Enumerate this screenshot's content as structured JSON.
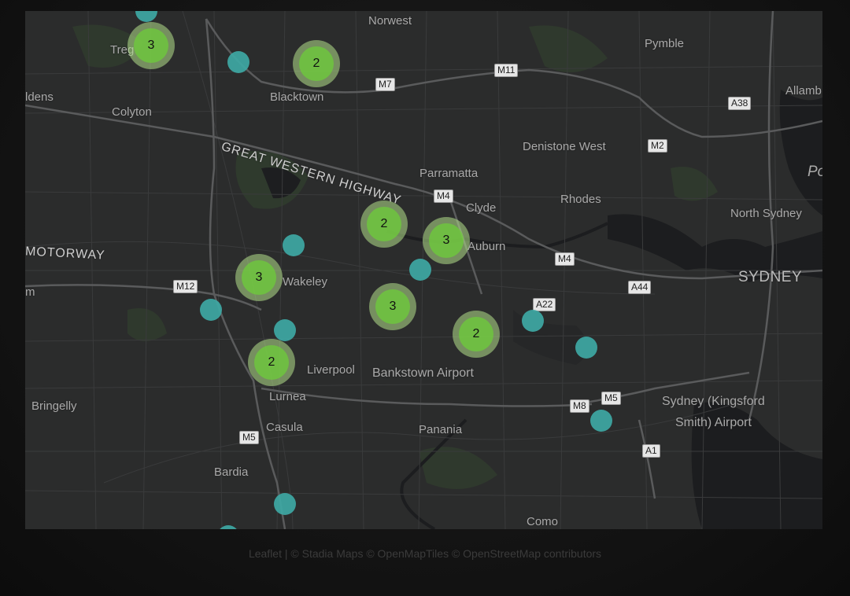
{
  "map": {
    "places": [
      {
        "key": "norwest",
        "text": "Norwest"
      },
      {
        "key": "pymble",
        "text": "Pymble"
      },
      {
        "key": "allamb",
        "text": "Allamb"
      },
      {
        "key": "tregear",
        "text": "Treg"
      },
      {
        "key": "blacktown",
        "text": "Blacktown"
      },
      {
        "key": "eldens",
        "text": "ldens"
      },
      {
        "key": "colyton",
        "text": "Colyton"
      },
      {
        "key": "denistone",
        "text": "Denistone West"
      },
      {
        "key": "parramatta",
        "text": "Parramatta"
      },
      {
        "key": "clyde",
        "text": "Clyde"
      },
      {
        "key": "rhodes",
        "text": "Rhodes"
      },
      {
        "key": "north_sydney",
        "text": "North Sydney"
      },
      {
        "key": "auburn",
        "text": "Auburn"
      },
      {
        "key": "wakeley",
        "text": "Wakeley"
      },
      {
        "key": "sydney",
        "text": "SYDNEY"
      },
      {
        "key": "liverpool",
        "text": "Liverpool"
      },
      {
        "key": "bankstown",
        "text": "Bankstown Airport"
      },
      {
        "key": "bringelly",
        "text": "Bringelly"
      },
      {
        "key": "lurnea",
        "text": "Lurnea"
      },
      {
        "key": "casula",
        "text": "Casula"
      },
      {
        "key": "panania",
        "text": "Panania"
      },
      {
        "key": "kingsford",
        "text": "Sydney (Kingsford"
      },
      {
        "key": "kingsford2",
        "text": "Smith) Airport"
      },
      {
        "key": "bardia",
        "text": "Bardia"
      },
      {
        "key": "como",
        "text": "Como"
      },
      {
        "key": "m_edge",
        "text": "m"
      },
      {
        "key": "po",
        "text": "Po"
      }
    ],
    "roads": {
      "gwh": "GREAT WESTERN HIGHWAY",
      "motorway": "MOTORWAY"
    },
    "shields": [
      "M7",
      "M11",
      "A38",
      "M2",
      "M4",
      "M4",
      "M12",
      "A44",
      "A22",
      "M5",
      "M8",
      "A1",
      "M5"
    ],
    "clusters": [
      "3",
      "2",
      "2",
      "3",
      "3",
      "3",
      "2",
      "2"
    ],
    "marker_count": 11,
    "colors": {
      "cluster_outer": "#b5e28c",
      "cluster_inner": "#6ecc39",
      "marker": "#3ea8a4",
      "water": "#1c1d1f",
      "land": "#2b2c2c",
      "park": "#2f3a2c"
    }
  },
  "attribution": {
    "leaflet": "Leaflet",
    "sep": " | ",
    "rest": "© Stadia Maps © OpenMapTiles © OpenStreetMap contributors"
  }
}
